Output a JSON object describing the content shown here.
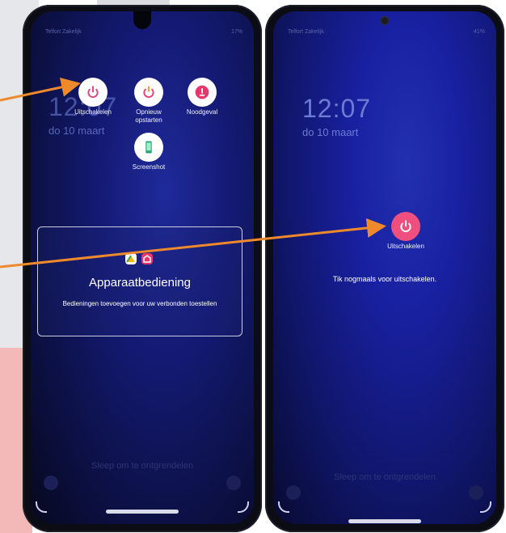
{
  "colors": {
    "annotation_arrow": "#ef8a2c",
    "power_pink": "#ef4f7e",
    "screen_blue": "#141a74"
  },
  "left_phone": {
    "carrier": "Telfort Zakelijk",
    "status_right": "17%",
    "time": "12:07",
    "date": "do 10 maart",
    "power_menu": {
      "power_off": {
        "label": "Uitschakelen",
        "icon": "power-icon"
      },
      "restart": {
        "label_line1": "Opnieuw",
        "label_line2": "opstarten",
        "icon": "restart-icon"
      },
      "emergency": {
        "label": "Noodgeval",
        "icon": "emergency-icon"
      },
      "screenshot": {
        "label": "Screenshot",
        "icon": "screenshot-icon"
      }
    },
    "device_controls": {
      "title": "Apparaatbediening",
      "subtitle": "Bedieningen toevoegen voor uw verbonden toestellen"
    },
    "swipe_hint": "Sleep om te ontgrendelen"
  },
  "right_phone": {
    "carrier": "Telfort Zakelijk",
    "status_right": "41%",
    "time": "12:07",
    "date": "do 10 maart",
    "power_off_label": "Uitschakelen",
    "confirm_text": "Tik nogmaals voor uitschakelen.",
    "swipe_hint": "Sleep om te ontgrendelen"
  }
}
